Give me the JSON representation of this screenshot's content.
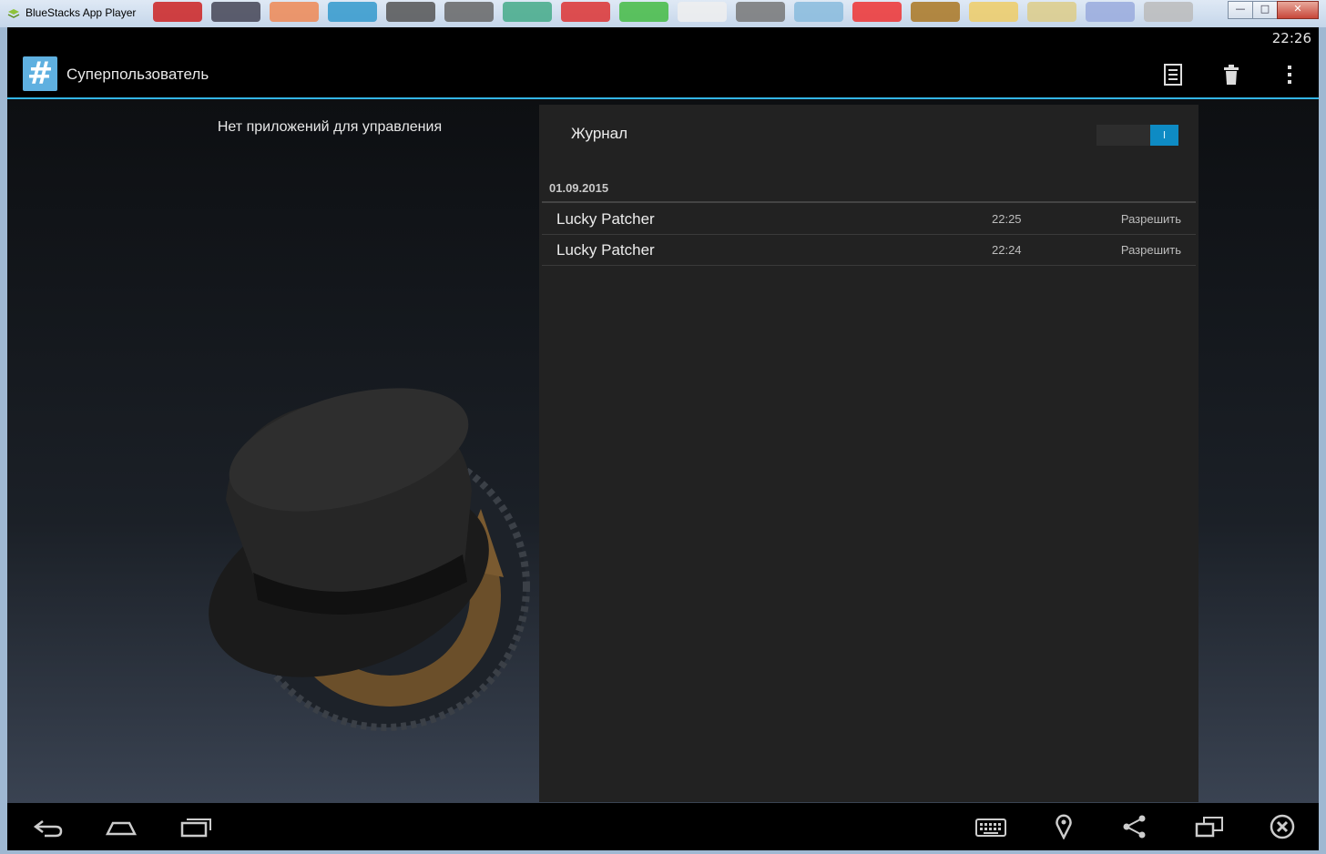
{
  "window": {
    "title": "BlueStacks App Player",
    "controls": {
      "minimize": "—",
      "maximize": "□",
      "close": "✕"
    }
  },
  "statusbar": {
    "time": "22:26"
  },
  "actionbar": {
    "app_icon": "hash-icon",
    "title": "Суперпользователь",
    "actions": [
      "log-list-icon",
      "trash-icon",
      "overflow-menu-icon"
    ]
  },
  "left_pane": {
    "message": "Нет приложений для управления",
    "illustration": "clockworkmod-hat-gear"
  },
  "log_panel": {
    "label": "Журнал",
    "toggle": {
      "state": "on",
      "on_text": "I"
    },
    "date": "01.09.2015",
    "entries": [
      {
        "app": "Lucky Patcher",
        "time": "22:25",
        "action": "Разрешить"
      },
      {
        "app": "Lucky Patcher",
        "time": "22:24",
        "action": "Разрешить"
      }
    ]
  },
  "navbar": {
    "left": [
      "back-icon",
      "home-icon",
      "recent-apps-icon"
    ],
    "right": [
      "keyboard-icon",
      "location-pin-icon",
      "share-icon",
      "window-resize-icon",
      "close-circle-icon"
    ]
  },
  "colors": {
    "accent": "#33b5e5",
    "toggle_on": "#0e8bc4",
    "panel_bg": "#222222",
    "app_icon_bg": "#5fb0e0"
  }
}
